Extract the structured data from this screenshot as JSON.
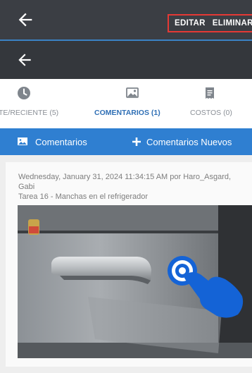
{
  "header": {
    "back_icon": "arrow-left-icon",
    "actions": {
      "edit_label": "EDITAR",
      "delete_label": "ELIMINAR"
    }
  },
  "subheader": {
    "back_icon": "arrow-left-icon"
  },
  "tabs": [
    {
      "label": "TE/RECIENTE (5)",
      "icon": "clock-icon",
      "active": false
    },
    {
      "label": "COMENTARIOS (1)",
      "icon": "photo-icon",
      "active": true
    },
    {
      "label": "COSTOS (0)",
      "icon": "receipt-icon",
      "active": false
    }
  ],
  "action_bar": {
    "comments_label": "Comentarios",
    "comments_icon": "photo-comment-icon",
    "new_comments_label": "Comentarios Nuevos",
    "new_comments_icon": "plus-icon"
  },
  "comment": {
    "meta": "Wednesday, January 31, 2024 11:34:15 AM por Haro_Asgard, Gabi",
    "task": "Tarea 16 - Manchas en el refrigerador"
  },
  "colors": {
    "topbar": "#3b3e44",
    "subbar": "#34373c",
    "accent": "#2f7fd1",
    "active_tab": "#2f6fb5",
    "highlight_border": "#e53935",
    "tap_gesture": "#1463d6"
  },
  "gesture_icon": "tap-hand-icon"
}
